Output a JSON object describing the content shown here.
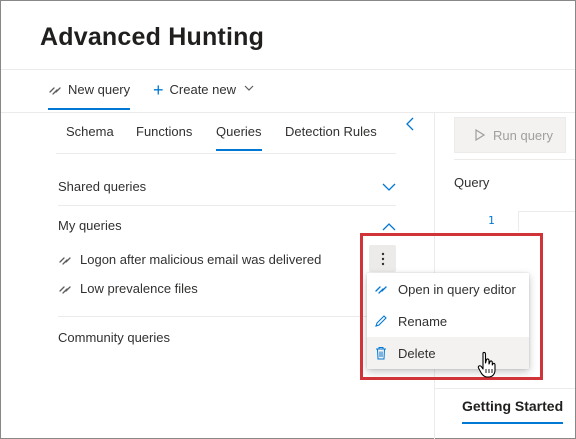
{
  "page": {
    "title": "Advanced Hunting"
  },
  "commandbar": {
    "new_query_label": "New query",
    "create_new_label": "Create new"
  },
  "tabs": [
    {
      "label": "Schema"
    },
    {
      "label": "Functions"
    },
    {
      "label": "Queries",
      "active": true
    },
    {
      "label": "Detection Rules"
    }
  ],
  "sections": {
    "shared": {
      "label": "Shared queries",
      "expanded": false
    },
    "my": {
      "label": "My queries",
      "expanded": true
    },
    "community": {
      "label": "Community queries"
    }
  },
  "my_queries": [
    {
      "label": "Logon after malicious email was delivered"
    },
    {
      "label": "Low prevalence files"
    }
  ],
  "context_menu": {
    "items": [
      {
        "label": "Open in query editor",
        "icon": "query-link-icon"
      },
      {
        "label": "Rename",
        "icon": "pencil-icon"
      },
      {
        "label": "Delete",
        "icon": "trash-icon",
        "hovered": true
      }
    ]
  },
  "editor": {
    "run_query_label": "Run query",
    "query_label": "Query",
    "line_number": "1"
  },
  "bottom_tabs": {
    "getting_started_label": "Getting Started"
  },
  "colors": {
    "accent": "#0078d4",
    "highlight": "#d13438"
  }
}
